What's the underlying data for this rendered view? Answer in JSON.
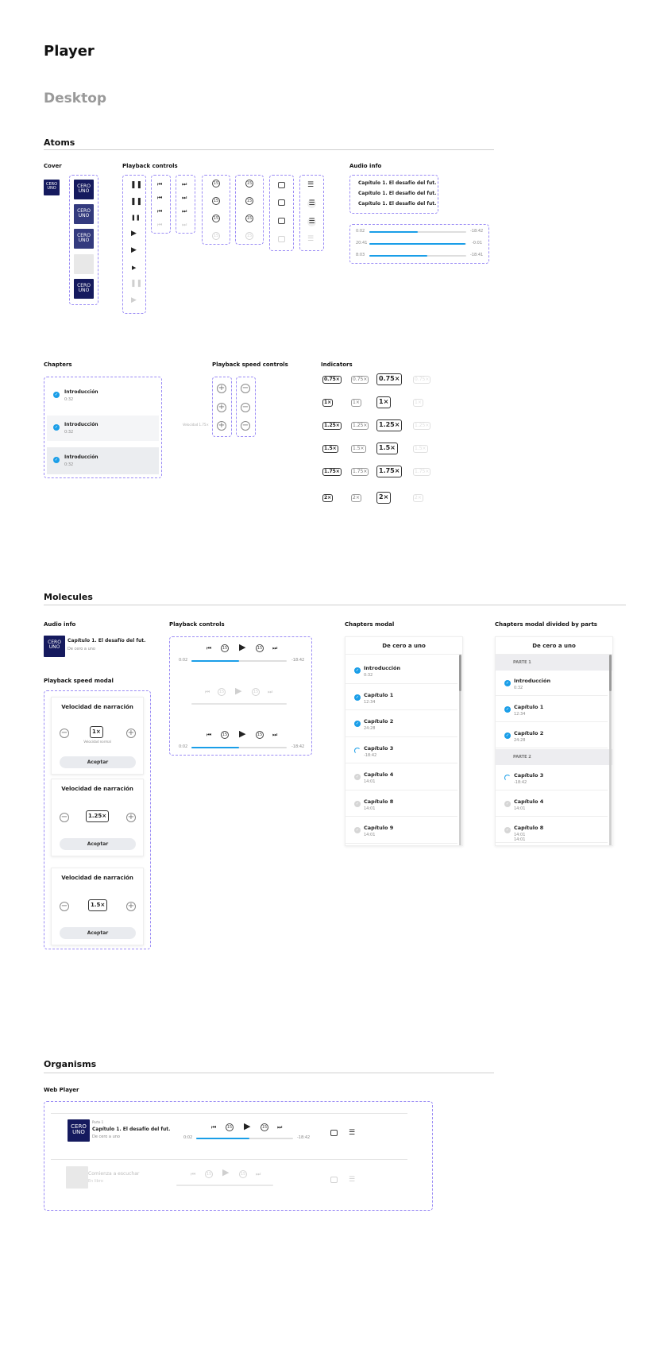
{
  "page": {
    "title": "Player",
    "subtitle": "Desktop"
  },
  "atoms": {
    "title": "Atoms",
    "cover_label": "Cover",
    "cover_text": "CERO UNO",
    "playback_label": "Playback controls",
    "audio_label": "Audio info",
    "audio_titles": [
      "Capítulo 1. El desafío del fut.",
      "Capítulo 1. El desafío del fut.",
      "Capítulo 1. El desafío del fut."
    ],
    "progress": [
      {
        "elapsed": "0:02",
        "remaining": "-18:42",
        "fill": 0.5
      },
      {
        "elapsed": "20:41",
        "remaining": "-0:01",
        "fill": 0.99
      },
      {
        "elapsed": "8:03",
        "remaining": "-18:41",
        "fill": 0.6
      }
    ],
    "chapters_label": "Chapters",
    "chapter_items": [
      {
        "title": "Introducción",
        "time": "0:32"
      },
      {
        "title": "Introducción",
        "time": "0:32"
      },
      {
        "title": "Introducción",
        "time": "0:32"
      }
    ],
    "speed_controls_label": "Playback speed controls",
    "speed_hint": "Velocidad 1.75×",
    "indicators_label": "Indicators",
    "indicators": [
      "0.75×",
      "1×",
      "1.25×",
      "1.5×",
      "1.75×",
      "2×"
    ]
  },
  "molecules": {
    "title": "Molecules",
    "audio_label": "Audio info",
    "audio_title": "Capítulo 1. El desafío del fut.",
    "audio_subtitle": "De cero a uno",
    "speed_modal_label": "Playback speed modal",
    "speed_modals": [
      {
        "title": "Velocidad de narración",
        "value": "1×",
        "note": "Velocidad normal",
        "button": "Aceptar"
      },
      {
        "title": "Velocidad de narración",
        "value": "1.25×",
        "note": "",
        "button": "Aceptar"
      },
      {
        "title": "Velocidad de narración",
        "value": "1.5×",
        "note": "",
        "button": "Aceptar"
      }
    ],
    "playback_label": "Playback controls",
    "playback_rows": [
      {
        "elapsed": "0:02",
        "remaining": "-18:42",
        "fill": 0.5
      },
      {
        "elapsed": "",
        "remaining": "",
        "fill": 0
      },
      {
        "elapsed": "0:02",
        "remaining": "-18:42",
        "fill": 0.5
      }
    ],
    "chapters_modal_label": "Chapters modal",
    "chapters_modal_title": "De cero a uno",
    "chapters_modal_items": [
      {
        "title": "Introducción",
        "time": "0:32",
        "state": "done"
      },
      {
        "title": "Capítulo 1",
        "time": "12:34",
        "state": "done"
      },
      {
        "title": "Capítulo 2",
        "time": "24:28",
        "state": "done"
      },
      {
        "title": "Capítulo 3",
        "time": "-18:42",
        "state": "progress"
      },
      {
        "title": "Capítulo 4",
        "time": "14:01",
        "state": "pending"
      },
      {
        "title": "Capítulo 8",
        "time": "14:01",
        "state": "pending"
      },
      {
        "title": "Capítulo 9",
        "time": "14:01",
        "state": "pending"
      }
    ],
    "parts_modal_label": "Chapters modal divided by parts",
    "parts_modal_title": "De cero a uno",
    "part1": "PARTE 1",
    "part2": "PARTE 2",
    "parts_items_1": [
      {
        "title": "Introducción",
        "time": "0:32",
        "state": "done"
      },
      {
        "title": "Capítulo 1",
        "time": "12:34",
        "state": "done"
      },
      {
        "title": "Capítulo 2",
        "time": "24:28",
        "state": "done"
      }
    ],
    "parts_items_2": [
      {
        "title": "Capítulo 3",
        "time": "-18:42",
        "state": "progress"
      },
      {
        "title": "Capítulo 4",
        "time": "14:01",
        "state": "pending"
      },
      {
        "title": "Capítulo 8",
        "time": "14:01",
        "state": "pending"
      }
    ],
    "parts_extra_time": "14:01"
  },
  "organisms": {
    "title": "Organisms",
    "web_player_label": "Web Player",
    "player": {
      "part": "Parte 1",
      "title": "Capítulo 1. El desafío del fut.",
      "author": "De cero a uno",
      "elapsed": "0:02",
      "remaining": "-18:42",
      "fill": 0.55
    },
    "empty_player": {
      "title": "Comienza a escuchar",
      "subtitle": "En libro"
    }
  },
  "colors": {
    "accent": "#1a9ee8",
    "cover": "#151a5e",
    "dashed": "#9b8cf5"
  }
}
